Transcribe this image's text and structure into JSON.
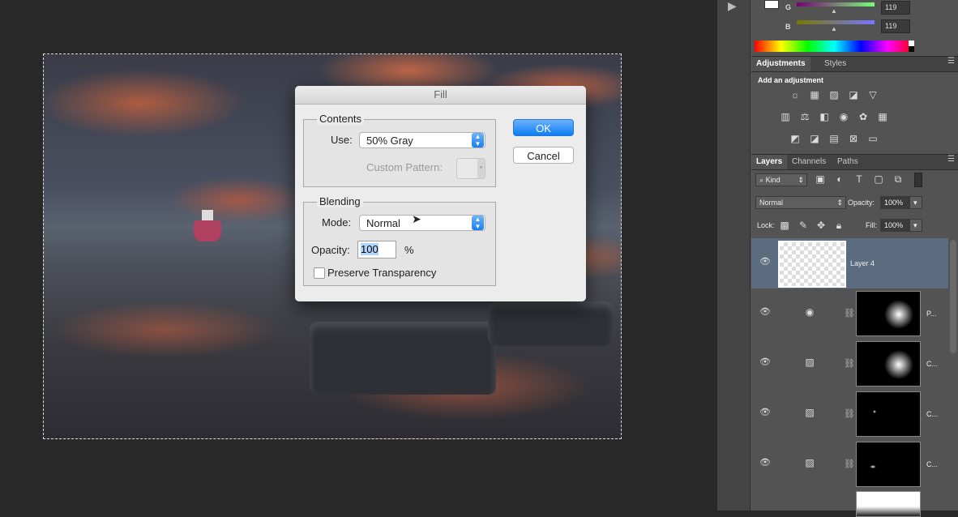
{
  "dialog": {
    "title": "Fill",
    "contents_label": "Contents",
    "use_label": "Use:",
    "use_value": "50% Gray",
    "custom_pattern_label": "Custom Pattern:",
    "blending_label": "Blending",
    "mode_label": "Mode:",
    "mode_value": "Normal",
    "opacity_label": "Opacity:",
    "opacity_value": "100",
    "opacity_unit": "%",
    "preserve_label": "Preserve Transparency",
    "ok_label": "OK",
    "cancel_label": "Cancel"
  },
  "color_panel": {
    "g_label": "G",
    "g_value": "119",
    "b_label": "B",
    "b_value": "119"
  },
  "adjustments": {
    "tabs": [
      "Adjustments",
      "Styles"
    ],
    "add_label": "Add an adjustment"
  },
  "layers": {
    "tabs": [
      "Layers",
      "Channels",
      "Paths"
    ],
    "kind_label": "Kind",
    "blend_mode": "Normal",
    "opacity_label": "Opacity:",
    "opacity_value": "100%",
    "lock_label": "Lock:",
    "fill_label": "Fill:",
    "fill_value": "100%",
    "items": [
      {
        "name": "Layer 4"
      },
      {
        "name": "P..."
      },
      {
        "name": "C..."
      },
      {
        "name": "C..."
      },
      {
        "name": "C..."
      }
    ]
  },
  "colors": {
    "selected_layer": "#5b6b80",
    "accent": "#1a7ff0"
  }
}
